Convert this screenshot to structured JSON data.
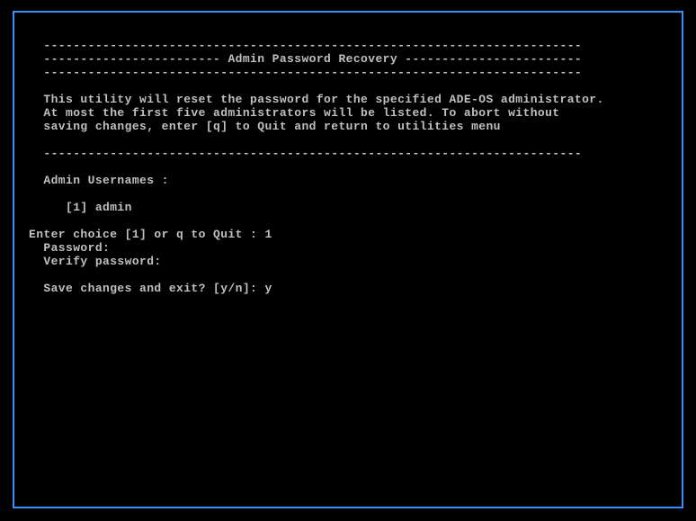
{
  "header": {
    "rule_top": "-------------------------------------------------------------------------",
    "title_line": "------------------------ Admin Password Recovery ------------------------",
    "rule_bottom": "-------------------------------------------------------------------------"
  },
  "description": {
    "line1": "This utility will reset the password for the specified ADE-OS administrator.",
    "line2": "At most the first five administrators will be listed. To abort without",
    "line3": "saving changes, enter [q] to Quit and return to utilities menu"
  },
  "separator": "-------------------------------------------------------------------------",
  "usernames_label": "Admin Usernames :",
  "usernames": {
    "item1": "[1] admin"
  },
  "prompts": {
    "choice_label": "Enter choice [1] or q to Quit : ",
    "choice_value": "1",
    "password_label": "Password:",
    "verify_label": "Verify password:",
    "save_label": "Save changes and exit? [y/n]: ",
    "save_value": "y"
  }
}
